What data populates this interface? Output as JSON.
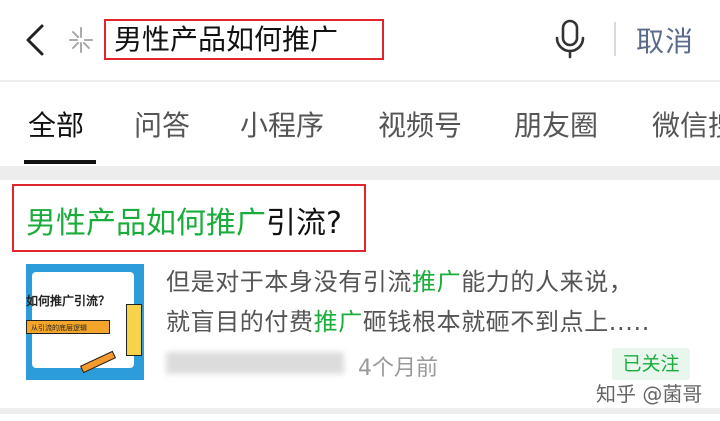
{
  "search": {
    "query": "男性产品如何推广",
    "cancel_label": "取消"
  },
  "tabs": [
    {
      "label": "全部",
      "active": true
    },
    {
      "label": "问答"
    },
    {
      "label": "小程序"
    },
    {
      "label": "视频号"
    },
    {
      "label": "朋友圈"
    },
    {
      "label": "微信搜"
    }
  ],
  "result": {
    "title_highlight": "男性产品如何推广",
    "title_rest": "引流?",
    "thumbnail_text": "如何推广引流？",
    "thumbnail_subtext": "从引流的底层逻辑",
    "snippet_line1_pre": "但是对于本身没有引流",
    "snippet_line1_hl": "推广",
    "snippet_line1_post": "能力的人来说，",
    "snippet_line2_pre": "就盲目的付费",
    "snippet_line2_hl": "推广",
    "snippet_line2_post": "砸钱根本就砸不到点上.....",
    "time": "4个月前",
    "follow_status": "已关注"
  },
  "watermark": "知乎 @菌哥",
  "colors": {
    "highlight": "#1aad3c",
    "annotation_box": "#e0252d",
    "link_blue": "#5b6b8c"
  },
  "icons": [
    "back-icon",
    "sparkle-icon",
    "microphone-icon"
  ]
}
